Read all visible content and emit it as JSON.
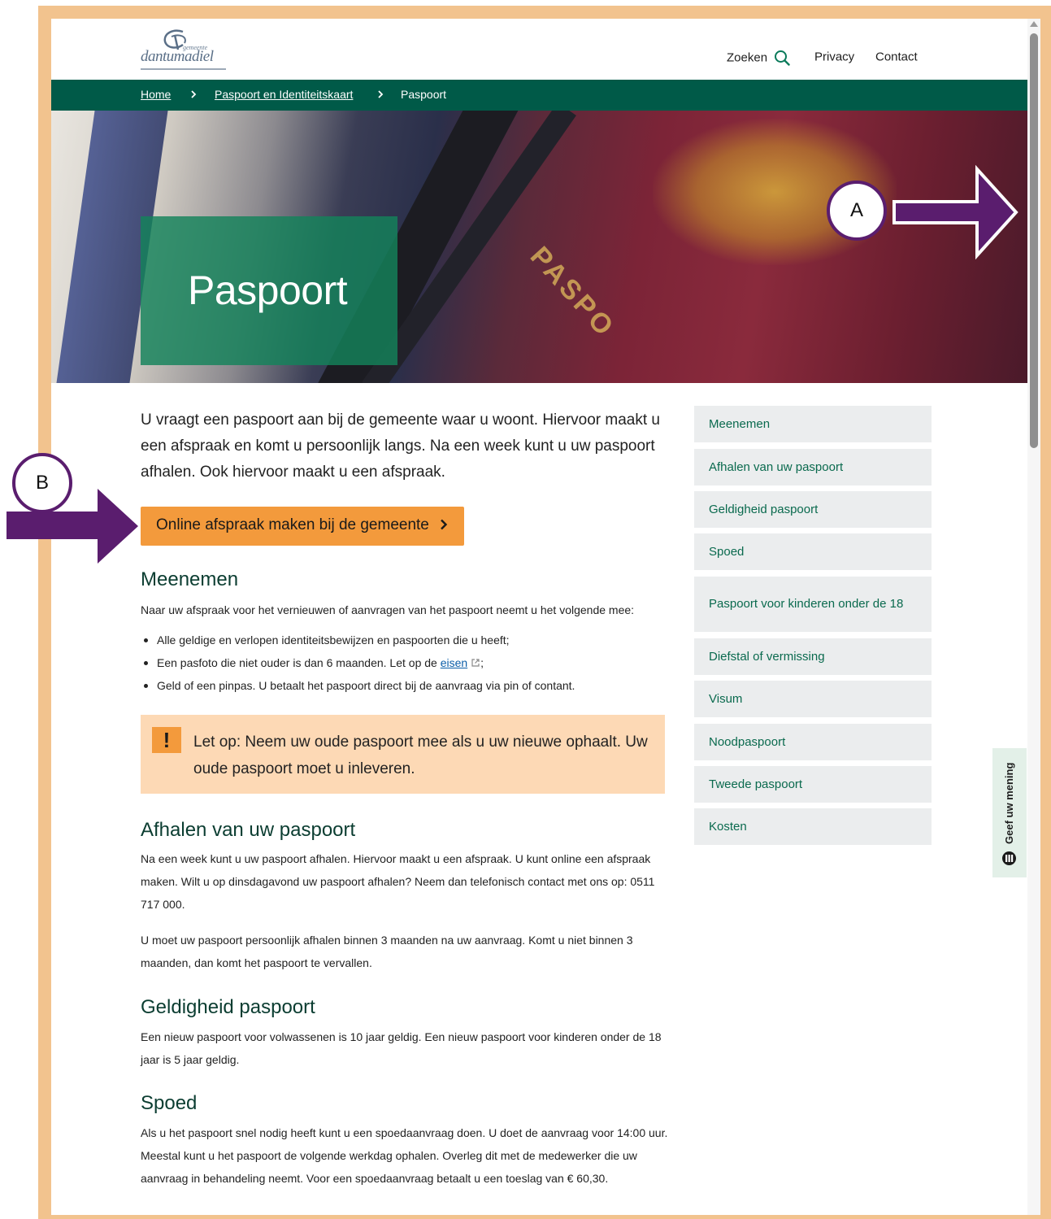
{
  "header": {
    "logo_small": "gemeente",
    "logo_name": "dantumadiel",
    "nav": {
      "search": "Zoeken",
      "privacy": "Privacy",
      "contact": "Contact"
    }
  },
  "breadcrumb": {
    "home": "Home",
    "parent": "Paspoort en Identiteitskaart",
    "current": "Paspoort"
  },
  "hero": {
    "title": "Paspoort",
    "image_word": "PASPO"
  },
  "intro": "U vraagt een paspoort aan bij de gemeente waar u woont. Hiervoor maakt u een afspraak en komt u persoonlijk langs. Na een week kunt u uw paspoort afhalen. Ook hiervoor maakt u een afspraak.",
  "cta_label": "Online afspraak maken bij de gemeente",
  "meenemen": {
    "title": "Meenemen",
    "text": "Naar uw afspraak voor het vernieuwen of aanvragen van het paspoort neemt u het volgende mee:",
    "items": {
      "item1": "Alle geldige en verlopen identiteitsbewijzen en paspoorten die u heeft;",
      "item2_before": "Een pasfoto die niet ouder is dan 6 maanden. Let op de",
      "item2_link": "eisen",
      "item2_after": ";",
      "item3": "Geld of een pinpas. U betaalt het paspoort direct bij de aanvraag via pin of contant."
    }
  },
  "warning": {
    "icon": "!",
    "text": "Let op: Neem uw oude paspoort mee als u uw nieuwe ophaalt. Uw oude paspoort moet u inleveren."
  },
  "afhalen": {
    "title": "Afhalen van uw paspoort",
    "p1": "Na een week kunt u uw paspoort afhalen. Hiervoor maakt u een afspraak. U kunt online een afspraak maken. Wilt u op dinsdagavond uw paspoort afhalen? Neem dan telefonisch contact met ons op: 0511 717 000.",
    "p2": "U moet uw paspoort persoonlijk afhalen binnen 3 maanden na uw aanvraag. Komt u niet binnen 3 maanden, dan komt het paspoort te vervallen."
  },
  "geldigheid": {
    "title": "Geldigheid paspoort",
    "text": "Een nieuw paspoort voor volwassenen is 10 jaar geldig. Een nieuw paspoort voor kinderen onder de 18 jaar is 5 jaar geldig."
  },
  "spoed": {
    "title": "Spoed",
    "text": "Als u het paspoort snel nodig heeft kunt u een spoedaanvraag doen. U doet de aanvraag voor 14:00 uur. Meestal kunt u het paspoort de volgende werkdag ophalen. Overleg dit met de medewerker die uw aanvraag in behandeling neemt. Voor een spoedaanvraag betaalt u een toeslag van € 60,30."
  },
  "sidebar": {
    "items": [
      "Meenemen",
      "Afhalen van uw paspoort",
      "Geldigheid paspoort",
      "Spoed",
      "Paspoort voor kinderen onder de 18",
      "Diefstal of vermissing",
      "Visum",
      "Noodpaspoort",
      "Tweede paspoort",
      "Kosten"
    ]
  },
  "feedback_label": "Geef uw mening",
  "annotations": {
    "a": "A",
    "b": "B",
    "arrow_color": "#5a1d6e"
  },
  "colors": {
    "brand_green": "#005a48",
    "link_green": "#0a6a4e",
    "cta_orange": "#f39a3c",
    "warning_bg": "#fdd9b5",
    "frame": "#f2c38e"
  },
  "icons": {
    "search": "search-icon",
    "breadcrumb_separator": "chevron-right-icon",
    "cta": "chevron-right-icon",
    "external": "external-link-icon",
    "warning": "exclamation-icon",
    "feedback": "feedback-logo-icon"
  }
}
